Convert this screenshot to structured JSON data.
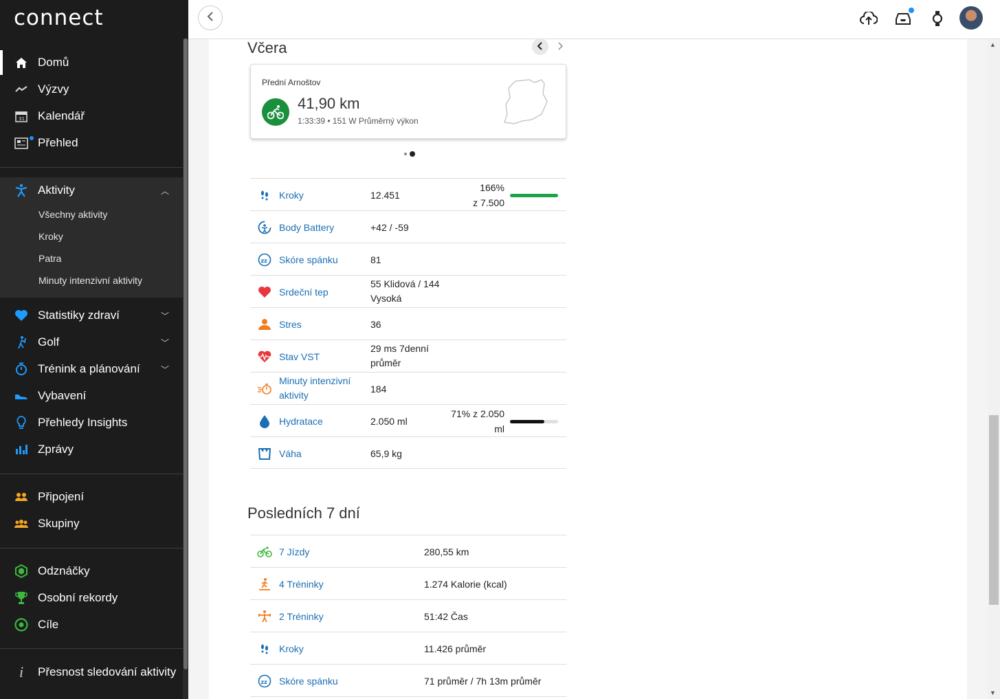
{
  "app": {
    "logo": "connect"
  },
  "sidebar": {
    "main_items": [
      {
        "label": "Domů",
        "icon": "home-icon"
      },
      {
        "label": "Výzvy",
        "icon": "challenge-icon"
      },
      {
        "label": "Kalendář",
        "icon": "calendar-icon"
      },
      {
        "label": "Přehled",
        "icon": "news-icon"
      }
    ],
    "activities": {
      "label": "Aktivity",
      "sub_items": [
        "Všechny aktivity",
        "Kroky",
        "Patra",
        "Minuty intenzivní aktivity"
      ]
    },
    "more_items": [
      {
        "label": "Statistiky zdraví",
        "icon": "heart-icon"
      },
      {
        "label": "Golf",
        "icon": "golf-icon"
      },
      {
        "label": "Trénink a plánování",
        "icon": "stopwatch-icon"
      },
      {
        "label": "Vybavení",
        "icon": "shoe-icon"
      },
      {
        "label": "Přehledy Insights",
        "icon": "lightbulb-icon"
      },
      {
        "label": "Zprávy",
        "icon": "bar-chart-icon"
      }
    ],
    "social_items": [
      {
        "label": "Připojení",
        "icon": "connections-icon"
      },
      {
        "label": "Skupiny",
        "icon": "groups-icon"
      }
    ],
    "goal_items": [
      {
        "label": "Odznáčky",
        "icon": "badge-icon"
      },
      {
        "label": "Osobní rekordy",
        "icon": "trophy-icon"
      },
      {
        "label": "Cíle",
        "icon": "target-icon"
      }
    ],
    "footer_item": {
      "label": "Přesnost sledování aktivity",
      "icon": "info-icon"
    }
  },
  "header": {
    "icons": [
      "back-icon",
      "upload-cloud-icon",
      "inbox-icon",
      "watch-icon",
      "avatar"
    ]
  },
  "yesterday": {
    "title": "Včera",
    "card": {
      "name": "Přední Arnoštov",
      "distance": "41,90 km",
      "details": "1:33:39 • 151 W Průměrný výkon"
    },
    "stats": [
      {
        "label": "Kroky",
        "value": "12.451",
        "goal_line1": "166%",
        "goal_line2": "z 7.500",
        "progress": 1.0,
        "bar_color": "#1aa34a",
        "icon": "footsteps-icon"
      },
      {
        "label": "Body Battery",
        "value": "+42 / -59",
        "icon": "body-battery-icon"
      },
      {
        "label": "Skóre spánku",
        "value": "81",
        "icon": "sleep-icon"
      },
      {
        "label": "Srdeční tep",
        "value_line1": "55 Klidová / 144",
        "value_line2": "Vysoká",
        "icon": "heart-rate-icon"
      },
      {
        "label": "Stres",
        "value": "36",
        "icon": "stress-icon"
      },
      {
        "label": "Stav VST",
        "value_line1": "29 ms 7denní",
        "value_line2": "průměr",
        "icon": "hrv-icon"
      },
      {
        "label_line1": "Minuty intenzivní",
        "label_line2": "aktivity",
        "value": "184",
        "icon": "intensity-minutes-icon"
      },
      {
        "label": "Hydratace",
        "value": "2.050 ml",
        "goal_line1": "71% z 2.050",
        "goal_line2": "ml",
        "progress": 0.71,
        "bar_color": "#111111",
        "icon": "water-drop-icon"
      },
      {
        "label": "Váha",
        "value": "65,9 kg",
        "icon": "scale-icon"
      }
    ]
  },
  "last7": {
    "title": "Posledních 7 dní",
    "stats": [
      {
        "label": "7 Jízdy",
        "value": "280,55 km",
        "icon": "bike-icon"
      },
      {
        "label": "4 Tréninky",
        "value": "1.274 Kalorie (kcal)",
        "icon": "treadmill-icon"
      },
      {
        "label": "2 Tréninky",
        "value": "51:42 Čas",
        "icon": "strength-icon"
      },
      {
        "label": "Kroky",
        "value": "11.426 průměr",
        "icon": "footsteps-icon"
      },
      {
        "label": "Skóre spánku",
        "value": "71 průměr / 7h 13m průměr",
        "icon": "sleep-icon"
      }
    ]
  }
}
